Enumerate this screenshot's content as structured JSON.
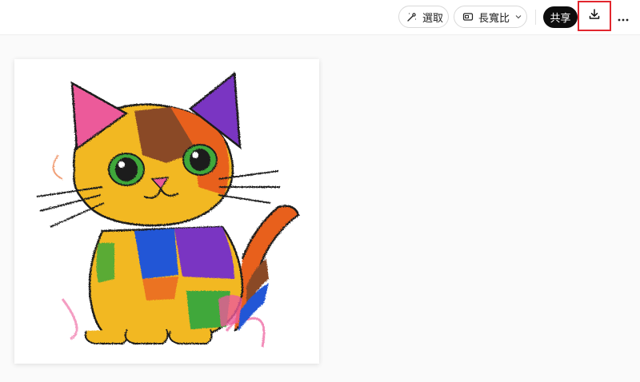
{
  "toolbar": {
    "select_label": "選取",
    "aspect_label": "長寬比",
    "share_label": "共享",
    "icons": {
      "select": "magic-select-icon",
      "aspect": "aspect-ratio-icon",
      "chevron": "chevron-down-icon",
      "download": "download-icon",
      "more": "more-horizontal-icon"
    }
  },
  "image": {
    "subject": "crayon-drawing-of-colorful-cat",
    "colors": {
      "yellow": "#f2b823",
      "orange": "#e8611f",
      "brown": "#8a4a26",
      "purple": "#7a35c2",
      "blue": "#2456d6",
      "pink": "#ec5a9a",
      "green": "#3fa83a",
      "outline": "#1a1a1a"
    }
  },
  "colors": {
    "share_bg": "#0d0d0d",
    "highlight_border": "#e2262e",
    "page_bg": "#fafafa"
  }
}
